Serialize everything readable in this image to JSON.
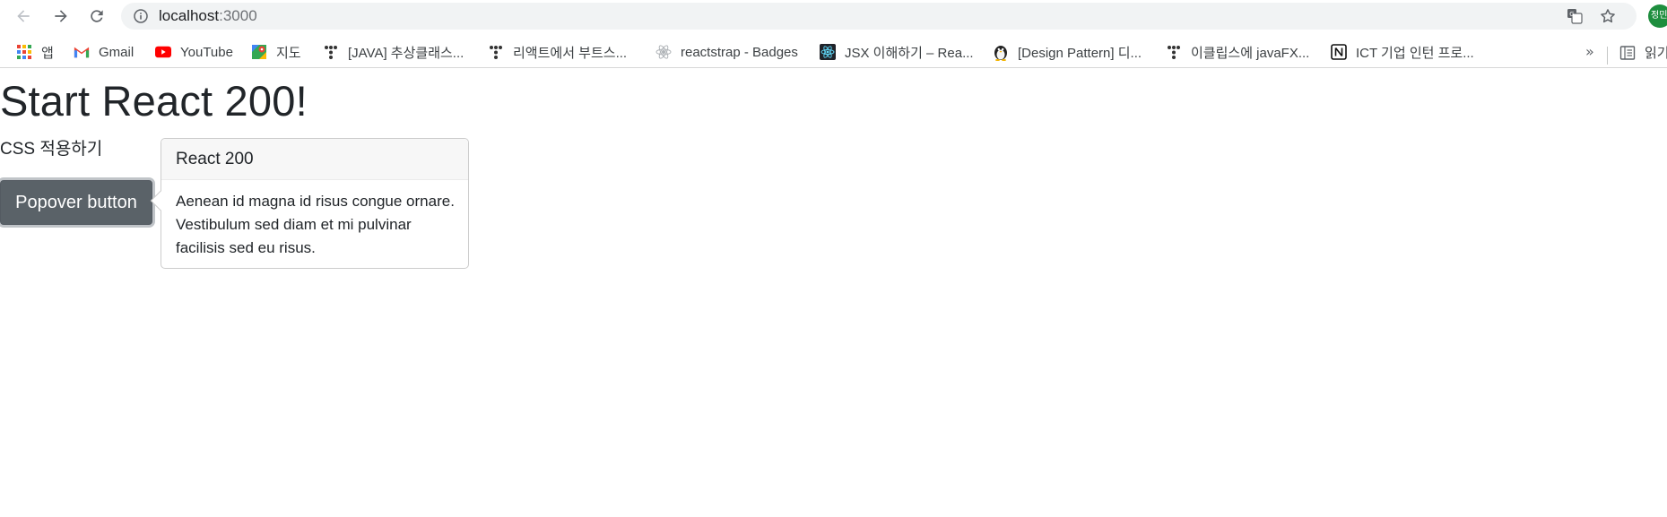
{
  "browser": {
    "url_host": "localhost",
    "url_port": ":3000",
    "profile_initial": "정민"
  },
  "bookmarks": {
    "items": [
      {
        "label": "앱",
        "icon": "apps-grid-icon"
      },
      {
        "label": "Gmail",
        "icon": "gmail-icon"
      },
      {
        "label": "YouTube",
        "icon": "youtube-icon"
      },
      {
        "label": "지도",
        "icon": "maps-icon"
      },
      {
        "label": "[JAVA] 추상클래스...",
        "icon": "tistory-icon"
      },
      {
        "label": "리액트에서 부트스...",
        "icon": "tistory-icon"
      },
      {
        "label": "reactstrap - Badges",
        "icon": "react-icon"
      },
      {
        "label": "JSX 이해하기 – Rea...",
        "icon": "react-dark-icon"
      },
      {
        "label": "[Design Pattern] 디...",
        "icon": "penguin-icon"
      },
      {
        "label": "이클립스에 javaFX...",
        "icon": "tistory-icon"
      },
      {
        "label": "ICT 기업 인턴 프로...",
        "icon": "notion-icon"
      }
    ],
    "more": "»",
    "reading_list": "읽기"
  },
  "page": {
    "title": "Start React 200!",
    "subtitle": "CSS 적용하기",
    "button_label": "Popover button"
  },
  "popover": {
    "header": "React 200",
    "body": "Aenean id magna id risus congue ornare. Vestibulum sed diam et mi pulvinar facilisis sed eu risus."
  }
}
